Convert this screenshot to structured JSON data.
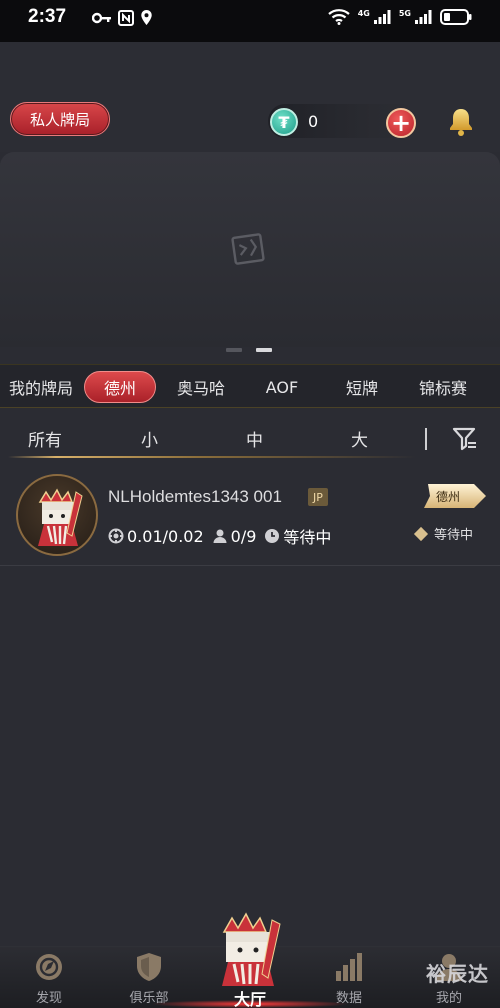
{
  "status_bar": {
    "time": "2:37",
    "signal_label_1": "4G",
    "signal_label_2": "5G"
  },
  "header": {
    "private_game_label": "私人牌局",
    "balance_value": "0",
    "icons": [
      "usdt-coin-icon",
      "add-funds-icon",
      "bell-icon"
    ]
  },
  "banner": {
    "page_count": 2,
    "active_page": 2
  },
  "game_tabs": [
    {
      "label": "我的牌局",
      "active": false
    },
    {
      "label": "德州",
      "active": true
    },
    {
      "label": "奥马哈",
      "active": false
    },
    {
      "label": "AOF",
      "active": false
    },
    {
      "label": "短牌",
      "active": false
    },
    {
      "label": "锦标赛",
      "active": false
    }
  ],
  "stake_filters": [
    {
      "label": "所有",
      "active": true
    },
    {
      "label": "小",
      "active": false
    },
    {
      "label": "中",
      "active": false
    },
    {
      "label": "大",
      "active": false
    }
  ],
  "rooms": [
    {
      "name": "NLHoldemtes1343 001",
      "badge": "JP",
      "blinds": "0.01/0.02",
      "players": "0/9",
      "state": "等待中",
      "game_type": "德州",
      "status": "等待中"
    }
  ],
  "bottom_nav": [
    {
      "label": "发现",
      "icon": "discover-icon"
    },
    {
      "label": "俱乐部",
      "icon": "shield-icon"
    },
    {
      "label": "大厅",
      "icon": "king-mascot-icon",
      "active": true
    },
    {
      "label": "数据",
      "icon": "bar-chart-icon"
    },
    {
      "label": "我的",
      "icon": "profile-icon"
    }
  ],
  "watermark": "裕辰达",
  "colors": {
    "accent_red": "#c9323a",
    "gold": "#d7b06a",
    "background": "#2b2c33"
  }
}
